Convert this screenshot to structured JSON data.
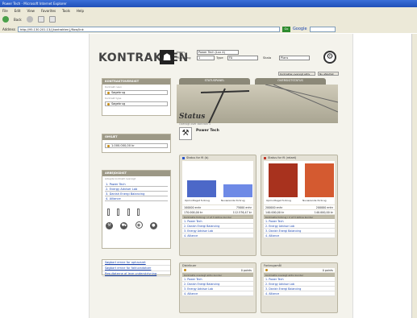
{
  "browser": {
    "title": "Power Tech - Microsoft Internet Explorer",
    "menu": [
      "File",
      "Edit",
      "View",
      "Favorites",
      "Tools",
      "Help"
    ],
    "back_label": "Back",
    "address_label": "Address",
    "url": "http://95.130.201.13/{kontrakten}/flow/link",
    "go_label": "Go",
    "google_label": "Google"
  },
  "header": {
    "logo": "KONTRAKTEN",
    "fields": [
      {
        "label": "Navn",
        "value": "Power Tech (Lux A)"
      },
      {
        "label": "Placering",
        "value": "1"
      },
      {
        "label": "Type",
        "value": "FA"
      },
      {
        "label": "Skala",
        "value": "Plans"
      }
    ],
    "small_buttons": [
      "Kontrakter-oversigt aktiv",
      "Nu afsluttet"
    ]
  },
  "left": {
    "search_panel": {
      "title": "KONTRAKTOVERSIGT",
      "sub1": "Kontrakt navn",
      "field1": "Søgebrug",
      "sub2": "Kontrakt type",
      "field2": "Søgebrug"
    },
    "value_panel": {
      "title": "OMSÆT",
      "value": "1.000.000,00 kr"
    },
    "tree_panel": {
      "title": "ARBEJDSDIST",
      "sub": "Arbejds kontrakt oversigt",
      "items": [
        "1. Power Tech",
        "2. Energy Adviser Lab",
        "3. Danish Energi Balancing",
        "4. Alliance"
      ]
    },
    "links": [
      "Søgbart emne for ophavsret",
      "Søgbart emne for fakturadatoer",
      "Resultaterne af leve underskrivning"
    ]
  },
  "center": {
    "tabs": [
      "STATUSPANEL",
      "OVERSIGTSTATUS"
    ],
    "status_title": "Status",
    "status_sub": "Oversigt over kontrakt 1",
    "company": "Power Tech",
    "card1": {
      "header": "Status for fil (b)",
      "bar_labels": [
        "Opmodtaget forbrug",
        "Nuværende forbrug"
      ],
      "rows": [
        {
          "left": "100000 enhr",
          "right": "75000 enhr"
        },
        {
          "left": "170.000,00 kr",
          "right": "112.576,47 kr"
        }
      ],
      "table_title": "Kontrakts forbrug i 2 af 3 aktive kunder",
      "links": [
        "1. Power Tech",
        "2. Danish Energi Balancing",
        "3. Energy Advisor Lab",
        "4. Alliance"
      ]
    },
    "card2": {
      "header": "Status for fil (relaet)",
      "bar_labels": [
        "Opmodtaget forbrug",
        "Nuværende forbrug"
      ],
      "rows": [
        {
          "left": "200000 enhr",
          "right": "200000 enhr"
        },
        {
          "left": "140.000,00 kr",
          "right": "140.000,00 kr"
        }
      ],
      "table_title": "Kontrakts forbrug i 2 af 3 aktive kunder",
      "links": [
        "1. Power Tech",
        "2. Energy Advisor Lab",
        "3. Danish Energi Balancing",
        "4. Alliance"
      ]
    },
    "card3": {
      "header": "Distribuer",
      "value": "0 points",
      "table_title": "Kontrakts oversigt aktiv kunder",
      "links": [
        "1. Power Tech",
        "2. Danish Energi Balancing",
        "3. Energy Advisor Lab",
        "4. Alliance"
      ]
    },
    "card4": {
      "header": "Forbrugsmål",
      "value": "0 points",
      "table_title": "Kontrakts oversigt aktiv kunder",
      "links": [
        "1. Power Tech",
        "2. Energy Advisor Lab",
        "3. Danish Energi Balancing",
        "4. Alliance"
      ]
    }
  },
  "chart_data": [
    {
      "type": "bar",
      "categories": [
        "Opmodtaget forbrug",
        "Nuværende forbrug"
      ],
      "values": [
        100000,
        75000
      ],
      "colors": [
        "#4c68c8",
        "#6e8ae6"
      ]
    },
    {
      "type": "bar",
      "categories": [
        "Opmodtaget forbrug",
        "Nuværende forbrug"
      ],
      "values": [
        200000,
        200000
      ],
      "colors": [
        "#a8321e",
        "#d45a30"
      ]
    }
  ]
}
